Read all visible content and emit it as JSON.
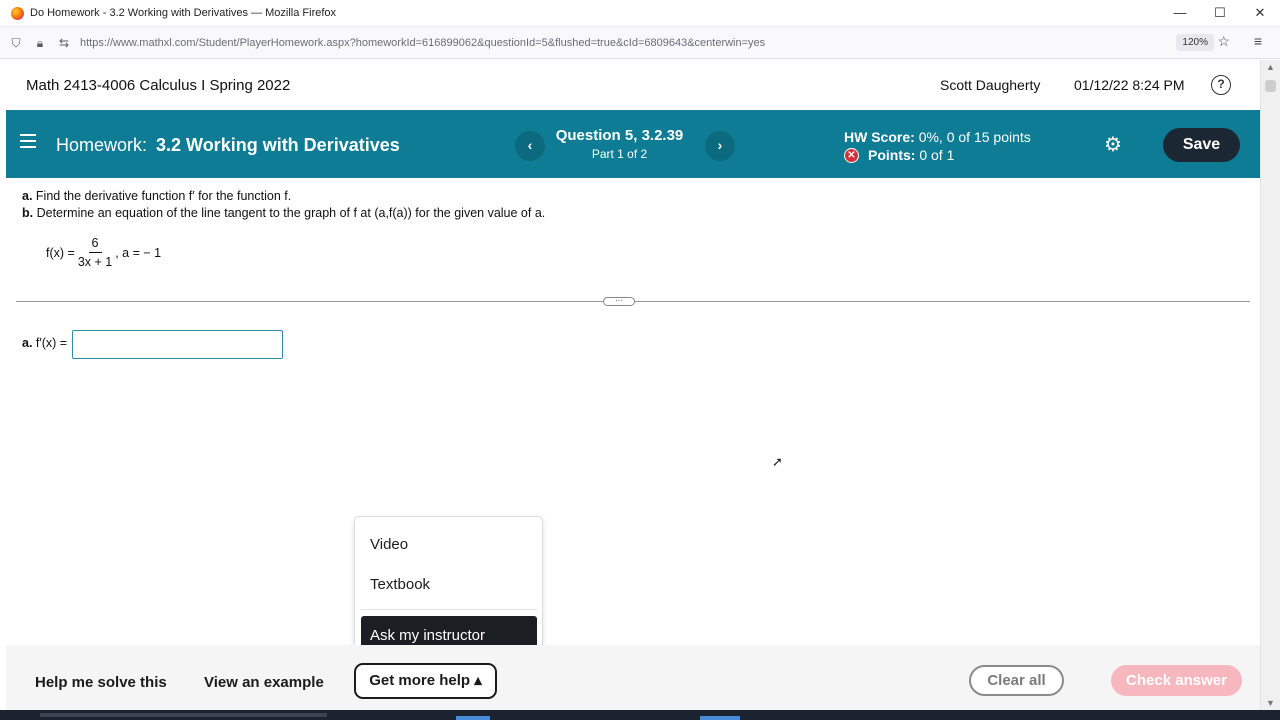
{
  "window": {
    "title": "Do Homework - 3.2 Working with Derivatives — Mozilla Firefox",
    "controls": [
      "—",
      "☐",
      "✕"
    ]
  },
  "browser": {
    "url": "https://www.mathxl.com/Student/PlayerHomework.aspx?homeworkId=616899062&questionId=5&flushed=true&cId=6809643&centerwin=yes",
    "zoom": "120%"
  },
  "header": {
    "course": "Math 2413-4006 Calculus I Spring 2022",
    "user": "Scott Daugherty",
    "datetime": "01/12/22 8:24 PM",
    "help_glyph": "?"
  },
  "hwbar": {
    "label": "Homework:",
    "name": "3.2 Working with Derivatives",
    "question_title": "Question 5, 3.2.39",
    "question_part": "Part 1 of 2",
    "score_label": "HW Score:",
    "score_value": "0%, 0 of 15 points",
    "points_label": "Points:",
    "points_value": "0 of 1",
    "save_label": "Save",
    "prev_glyph": "‹",
    "next_glyph": "›"
  },
  "question": {
    "part_a_letter": "a.",
    "part_a_text": "Find the derivative function f′ for the function f.",
    "part_b_letter": "b.",
    "part_b_text": "Determine an equation of the line tangent to the graph of f at (a,f(a)) for the given value of a.",
    "fx_lhs": "f(x) =",
    "numerator": "6",
    "denominator": "3x + 1",
    "a_value": ", a = − 1"
  },
  "answer": {
    "label_letter": "a.",
    "label_text": "f′(x) =",
    "value": ""
  },
  "help_menu": {
    "items": [
      "Video",
      "Textbook",
      "Ask my instructor"
    ]
  },
  "footer": {
    "solve": "Help me solve this",
    "example": "View an example",
    "more_help": "Get more help ▴",
    "clear": "Clear all",
    "check": "Check answer"
  },
  "colors": {
    "hwbar": "#0e7c94",
    "save_button": "#1b2833",
    "check_answer": "#f7b7be",
    "error_icon": "#d4313b"
  }
}
